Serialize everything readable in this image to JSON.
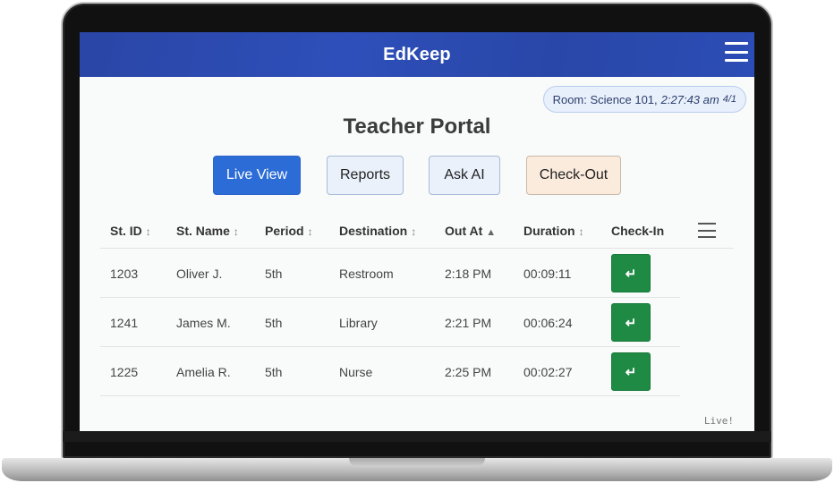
{
  "app": {
    "title": "EdKeep"
  },
  "room": {
    "label": "Room: Science 101,",
    "time": "2:27:43 am",
    "date": "4/1"
  },
  "page": {
    "title": "Teacher Portal"
  },
  "actions": {
    "live_view": "Live View",
    "reports": "Reports",
    "ask_ai": "Ask AI",
    "check_out": "Check-Out"
  },
  "table": {
    "columns": [
      {
        "label": "St. ID",
        "sort": "↕"
      },
      {
        "label": "St. Name",
        "sort": "↕"
      },
      {
        "label": "Period",
        "sort": "↕"
      },
      {
        "label": "Destination",
        "sort": "↕"
      },
      {
        "label": "Out At",
        "sort": "▲"
      },
      {
        "label": "Duration",
        "sort": "↕"
      },
      {
        "label": "Check-In",
        "sort": ""
      }
    ],
    "rows": [
      {
        "id": "1203",
        "name": "Oliver J.",
        "period": "5th",
        "destination": "Restroom",
        "out_at": "2:18 PM",
        "duration": "00:09:11",
        "checkin": "↵"
      },
      {
        "id": "1241",
        "name": "James M.",
        "period": "5th",
        "destination": "Library",
        "out_at": "2:21 PM",
        "duration": "00:06:24",
        "checkin": "↵"
      },
      {
        "id": "1225",
        "name": "Amelia R.",
        "period": "5th",
        "destination": "Nurse",
        "out_at": "2:25 PM",
        "duration": "00:02:27",
        "checkin": "↵"
      }
    ]
  },
  "status": {
    "live": "Live!"
  },
  "icons": {
    "menu": "hamburger-menu-icon",
    "columns_menu": "column-menu-icon",
    "checkin": "return-arrow-icon"
  },
  "colors": {
    "header_blue": "#2c4db6",
    "primary_button": "#2c6cd6",
    "checkin_green": "#1f8a44",
    "checkout_peach": "#fbebdc"
  }
}
